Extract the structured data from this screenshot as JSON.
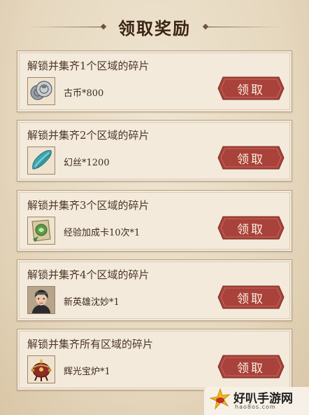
{
  "header": {
    "title": "领取奖励"
  },
  "rewards": [
    {
      "condition": "解锁并集齐1个区域的碎片",
      "item": "古币*800",
      "icon": "coin-icon",
      "button": "领取"
    },
    {
      "condition": "解锁并集齐2个区域的碎片",
      "item": "幻丝*1200",
      "icon": "silk-icon",
      "button": "领取"
    },
    {
      "condition": "解锁并集齐3个区域的碎片",
      "item": "经验加成卡10次*1",
      "icon": "exp-card-icon",
      "button": "领取"
    },
    {
      "condition": "解锁并集齐4个区域的碎片",
      "item": "新英雄沈妙*1",
      "icon": "hero-portrait-icon",
      "button": "领取"
    },
    {
      "condition": "解锁并集齐所有区域的碎片",
      "item": "辉光宝炉*1",
      "icon": "treasure-furnace-icon",
      "button": "领取"
    }
  ],
  "watermark": {
    "name": "好叭手游网",
    "domain": "hao8os.com"
  },
  "colors": {
    "button": "#a8423a",
    "card_bg": "#f3eadb",
    "page_bg": "#e6d8bf"
  }
}
